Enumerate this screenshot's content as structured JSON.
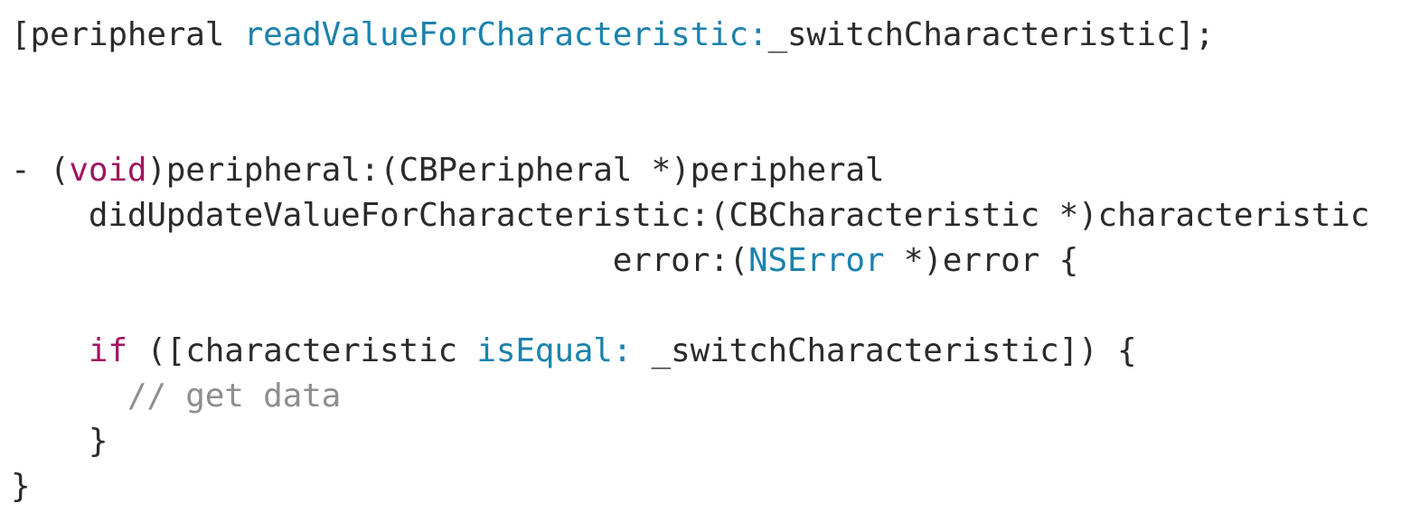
{
  "colors": {
    "text": "#2b2b2b",
    "keyword": "#a0165f",
    "method": "#1b82ad",
    "comment": "#8e8e8e",
    "background": "#ffffff"
  },
  "code": {
    "line1": {
      "open": "[peripheral ",
      "method": "readValueForCharacteristic:",
      "rest": "_switchCharacteristic];"
    },
    "line4": {
      "prefix": "- (",
      "type": "void",
      "rest": ")peripheral:(CBPeripheral *)peripheral"
    },
    "line5": {
      "text": "    didUpdateValueForCharacteristic:(CBCharacteristic *)characteristic"
    },
    "line6": {
      "prefix": "                               error:(",
      "type": "NSError",
      "rest": " *)error {"
    },
    "line8": {
      "indent": "    ",
      "keyword": "if",
      "mid": " ([characteristic ",
      "method": "isEqual:",
      "rest": " _switchCharacteristic]) {"
    },
    "line9": {
      "indent": "      ",
      "comment": "// get data"
    },
    "line10": {
      "text": "    }"
    },
    "line11": {
      "text": "}"
    }
  }
}
